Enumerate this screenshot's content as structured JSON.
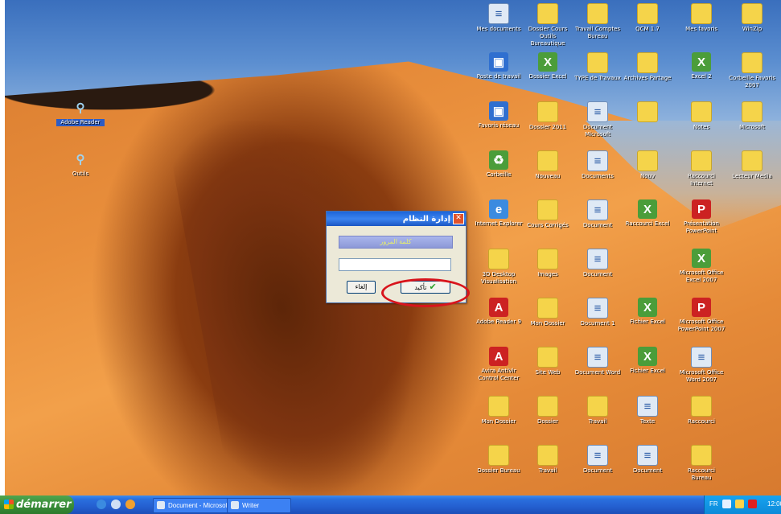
{
  "desktop": {
    "left_icons": [
      {
        "label": "Adobe Reader",
        "icon": "magnifier-icon",
        "selected": true
      },
      {
        "label": "Outils",
        "icon": "magnifier-icon",
        "selected": false
      }
    ],
    "grid_icons": [
      [
        "Mes documents",
        "Dossier Cours Outils Bureautique",
        "Travail Comptes Bureau",
        "QCM 1.7",
        "Mes favoris",
        "WinZip"
      ],
      [
        "Poste de travail",
        "Dossier Excel",
        "TYPE de Travaux",
        "Archives Partage",
        "Excel 2",
        "Corbeille Favoris 2007"
      ],
      [
        "Favoris réseau",
        "Dossier 2011",
        "Document Microsoft",
        "",
        "Notes",
        "Microsoft"
      ],
      [
        "Corbeille",
        "Nouveau",
        "Documents",
        "Nouv",
        "Raccourci Internet",
        "Lecteur Media"
      ],
      [
        "Internet Explorer",
        "Cours Corrigés",
        "Document",
        "Raccourci Excel",
        "Présentation PowerPoint",
        ""
      ],
      [
        "3D Desktop Visualisation",
        "Images",
        "Document",
        "",
        "Microsoft Office Excel 2007",
        ""
      ],
      [
        "Adobe Reader 9",
        "Mon Dossier",
        "Document 1",
        "Fichier Excel",
        "Microsoft Office PowerPoint 2007",
        ""
      ],
      [
        "Avira AntiVir Control Center",
        "Site Web",
        "Document Word",
        "Fichier Excel",
        "Microsoft Office Word 2007",
        ""
      ],
      [
        "Mon Dossier",
        "Dossier",
        "Travail",
        "Texte",
        "Raccourci",
        ""
      ],
      [
        "Dossier Bureau",
        "Travail",
        "Document",
        "Document",
        "Raccourci Bureau",
        ""
      ]
    ]
  },
  "dialog": {
    "title": "إدارة النظام",
    "banner": "كلمة المرور",
    "password_value": "",
    "ok_label": "تأكيد",
    "cancel_label": "إلغاء"
  },
  "taskbar": {
    "start_label": "démarrer",
    "tasks": [
      "Document - Microsoft",
      "Writer"
    ],
    "tray_lang": "FR",
    "clock": "12:00"
  },
  "colors": {
    "highlight_ellipse": "#d8141c",
    "titlebar": "#1d64d8",
    "taskbar": "#245fd0"
  }
}
